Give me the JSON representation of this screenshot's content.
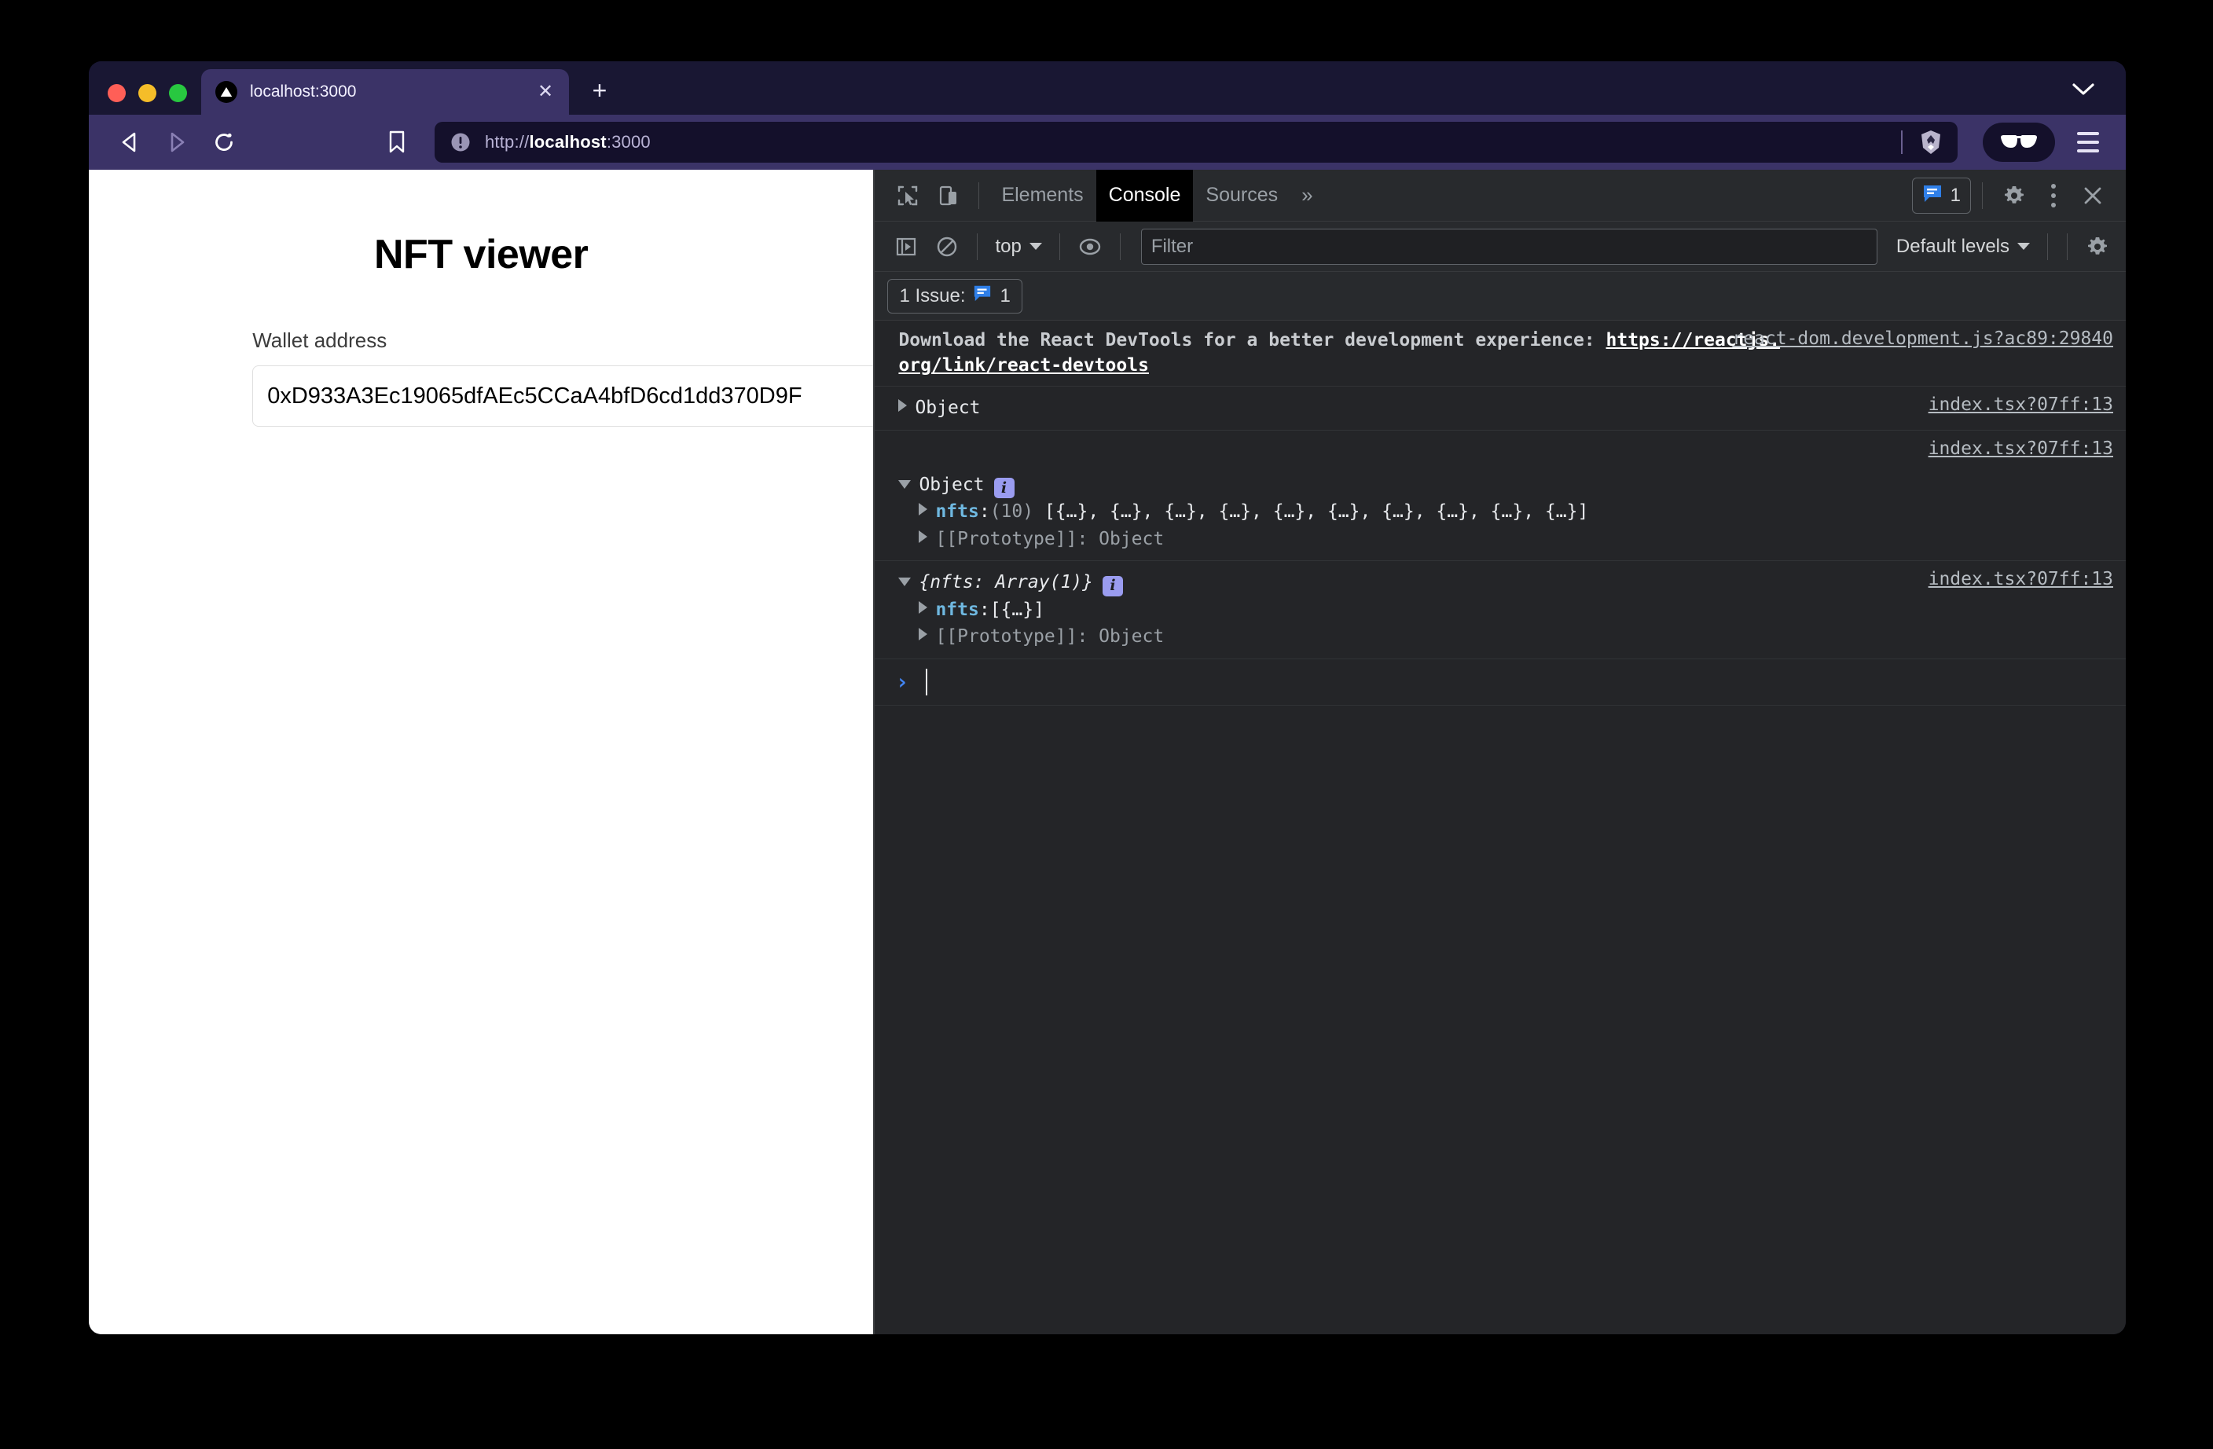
{
  "browser": {
    "traffic_lights": [
      "close",
      "minimize",
      "zoom"
    ],
    "tab": {
      "title": "localhost:3000",
      "favicon": "vercel-triangle-icon",
      "close_label": "✕"
    },
    "new_tab_label": "+",
    "tabstrip_chevron": "chevron-down-icon",
    "nav": {
      "back": "back-arrow-icon",
      "forward": "forward-arrow-icon",
      "reload": "reload-icon",
      "bookmark": "bookmark-icon"
    },
    "omnibox": {
      "site_info_icon": "not-secure-info-icon",
      "url_scheme": "http://",
      "url_host": "localhost",
      "url_port": ":3000",
      "full_url": "http://localhost:3000",
      "shields_icon": "brave-shields-lion-icon"
    },
    "glasses_button": "reader-glasses-icon",
    "menu_button": "hamburger-menu-icon"
  },
  "page": {
    "title": "NFT viewer",
    "wallet_label": "Wallet address",
    "wallet_value": "0xD933A3Ec19065dfAEc5CCaA4bfD6cd1dd370D9F",
    "wallet_placeholder": "Wallet address"
  },
  "devtools": {
    "toolbar": {
      "inspect_icon": "inspect-element-icon",
      "device_icon": "device-toolbar-icon",
      "tabs": [
        {
          "label": "Elements",
          "active": false
        },
        {
          "label": "Console",
          "active": true
        },
        {
          "label": "Sources",
          "active": false
        }
      ],
      "more_tabs": "»",
      "issues_icon": "issues-speech-bubble-icon",
      "issues_count": "1",
      "settings_icon": "gear-icon",
      "kebab_icon": "more-options-icon",
      "close_icon": "close-icon"
    },
    "filterbar": {
      "sidebar_icon": "console-sidebar-icon",
      "clear_icon": "clear-console-icon",
      "context": "top",
      "eye_icon": "live-expression-icon",
      "filter_placeholder": "Filter",
      "filter_value": "",
      "levels": "Default levels",
      "settings_icon": "console-settings-gear-icon"
    },
    "issues_banner": {
      "text": "1 Issue:",
      "icon": "issues-speech-bubble-icon",
      "count": "1"
    },
    "console_rows": [
      {
        "kind": "message",
        "source": "react-dom.development.js?ac89:29840",
        "text_before": "Download the React DevTools for a better development experience: ",
        "link_text": "https://reactjs.org/link/react-devtools"
      },
      {
        "kind": "object-collapsed",
        "source": "index.tsx?07ff:13",
        "triangle": "right",
        "label": "Object"
      },
      {
        "kind": "object-expanded",
        "source": "index.tsx?07ff:13",
        "triangle": "down",
        "label": "Object",
        "badge": "i",
        "children": [
          {
            "triangle": "right",
            "key": "nfts",
            "sep": ": ",
            "preview_count": "(10)",
            "preview": "[{…}, {…}, {…}, {…}, {…}, {…}, {…}, {…}, {…}, {…}]"
          },
          {
            "triangle": "right",
            "key": "",
            "sep": "",
            "preview_count": "",
            "preview": "[[Prototype]]: Object"
          }
        ]
      },
      {
        "kind": "object-expanded",
        "source": "index.tsx?07ff:13",
        "triangle": "down",
        "label": "{nfts: Array(1)}",
        "badge": "i",
        "children": [
          {
            "triangle": "right",
            "key": "nfts",
            "sep": ": ",
            "preview_count": "",
            "preview": "[{…}]"
          },
          {
            "triangle": "right",
            "key": "",
            "sep": "",
            "preview_count": "",
            "preview": "[[Prototype]]: Object"
          }
        ]
      }
    ],
    "prompt": {
      "caret": "›",
      "value": ""
    }
  },
  "colors": {
    "brave_chrome": "#3b3367",
    "tab_strip": "#191733",
    "omnibox_bg": "#14102b",
    "devtools_bg": "#242528",
    "devtools_panel": "#282a2d",
    "accent_blue": "#4285f4",
    "key_blue": "#6fb8e0",
    "badge_purple": "#9a9cf0"
  }
}
